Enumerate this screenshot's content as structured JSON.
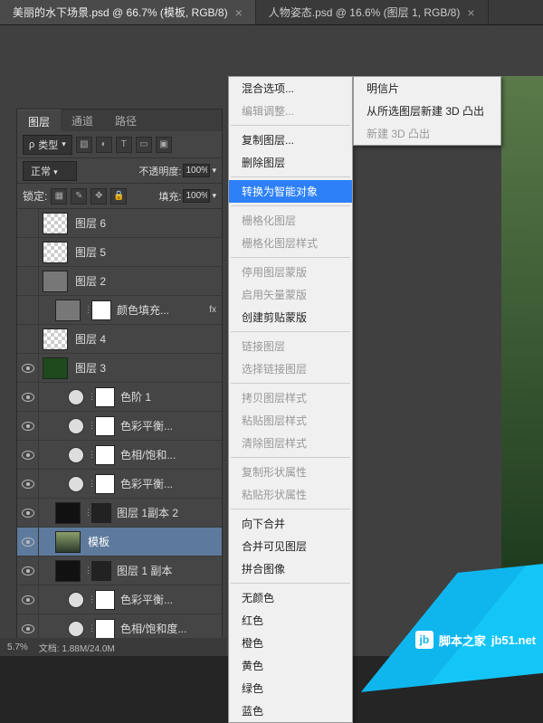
{
  "tabs": [
    {
      "title": "美丽的水下场景.psd @ 66.7% (模板, RGB/8)"
    },
    {
      "title": "人物姿态.psd @ 16.6% (图层 1, RGB/8)"
    }
  ],
  "panel": {
    "tabs": {
      "layers": "图层",
      "channels": "通道",
      "paths": "路径"
    },
    "filter_label": "类型",
    "blend_mode": "正常",
    "opacity_label": "不透明度:",
    "opacity_value": "100%",
    "lock_label": "锁定:",
    "fill_label": "填充:",
    "fill_value": "100%"
  },
  "layers": [
    {
      "name": "图层 6",
      "thumb": "checker",
      "ind": 0
    },
    {
      "name": "图层 5",
      "thumb": "checker",
      "ind": 0
    },
    {
      "name": "图层 2",
      "thumb": "gray",
      "ind": 0
    },
    {
      "name": "颜色填充...",
      "thumb": "gray",
      "ind": 1,
      "mask": true,
      "fx": "fx"
    },
    {
      "name": "图层 4",
      "thumb": "checker",
      "ind": 0
    },
    {
      "name": "图层 3",
      "thumb": "green",
      "ind": 0,
      "eye": true
    },
    {
      "name": "色阶 1",
      "adj": true,
      "ind": 2,
      "mask": true,
      "eye": true
    },
    {
      "name": "色彩平衡...",
      "adj": true,
      "ind": 2,
      "mask": true,
      "eye": true
    },
    {
      "name": "色相/饱和...",
      "adj": true,
      "ind": 2,
      "mask": true,
      "eye": true
    },
    {
      "name": "色彩平衡...",
      "adj": true,
      "ind": 2,
      "mask": true,
      "eye": true
    },
    {
      "name": "图层 1副本 2",
      "thumb": "black",
      "ind": 1,
      "maskdark": true,
      "eye": true
    },
    {
      "name": "模板",
      "thumb": "photo",
      "ind": 1,
      "selected": true,
      "eye": true
    },
    {
      "name": "图层 1 副本",
      "thumb": "black",
      "ind": 1,
      "maskdark": true,
      "eye": true
    },
    {
      "name": "色彩平衡...",
      "adj": true,
      "ind": 2,
      "mask": true,
      "eye": true
    },
    {
      "name": "色相/饱和度...",
      "adj": true,
      "ind": 2,
      "mask": true,
      "eye": true
    }
  ],
  "context_menu": {
    "groups": [
      [
        {
          "t": "混合选项...",
          "e": true
        },
        {
          "t": "编辑调整...",
          "e": false
        }
      ],
      [
        {
          "t": "复制图层...",
          "e": true
        },
        {
          "t": "删除图层",
          "e": true
        }
      ],
      [
        {
          "t": "转换为智能对象",
          "e": true,
          "hl": true
        }
      ],
      [
        {
          "t": "栅格化图层",
          "e": false
        },
        {
          "t": "栅格化图层样式",
          "e": false
        }
      ],
      [
        {
          "t": "停用图层蒙版",
          "e": false
        },
        {
          "t": "启用矢量蒙版",
          "e": false
        },
        {
          "t": "创建剪贴蒙版",
          "e": true
        }
      ],
      [
        {
          "t": "链接图层",
          "e": false
        },
        {
          "t": "选择链接图层",
          "e": false
        }
      ],
      [
        {
          "t": "拷贝图层样式",
          "e": false
        },
        {
          "t": "粘贴图层样式",
          "e": false
        },
        {
          "t": "清除图层样式",
          "e": false
        }
      ],
      [
        {
          "t": "复制形状属性",
          "e": false
        },
        {
          "t": "粘贴形状属性",
          "e": false
        }
      ],
      [
        {
          "t": "向下合并",
          "e": true
        },
        {
          "t": "合并可见图层",
          "e": true
        },
        {
          "t": "拼合图像",
          "e": true
        }
      ],
      [
        {
          "t": "无颜色",
          "e": true
        },
        {
          "t": "红色",
          "e": true
        },
        {
          "t": "橙色",
          "e": true
        },
        {
          "t": "黄色",
          "e": true
        },
        {
          "t": "绿色",
          "e": true
        },
        {
          "t": "蓝色",
          "e": true
        }
      ]
    ]
  },
  "submenu": [
    {
      "t": "明信片",
      "e": true
    },
    {
      "t": "从所选图层新建 3D 凸出",
      "e": true
    },
    {
      "t": "新建 3D 凸出",
      "e": false
    }
  ],
  "watermark": {
    "site": "jb51.net",
    "brand": "脚本之家"
  },
  "statusbar": {
    "zoom": "5.7%",
    "doc": "文档: 1.88M/24.0M"
  }
}
